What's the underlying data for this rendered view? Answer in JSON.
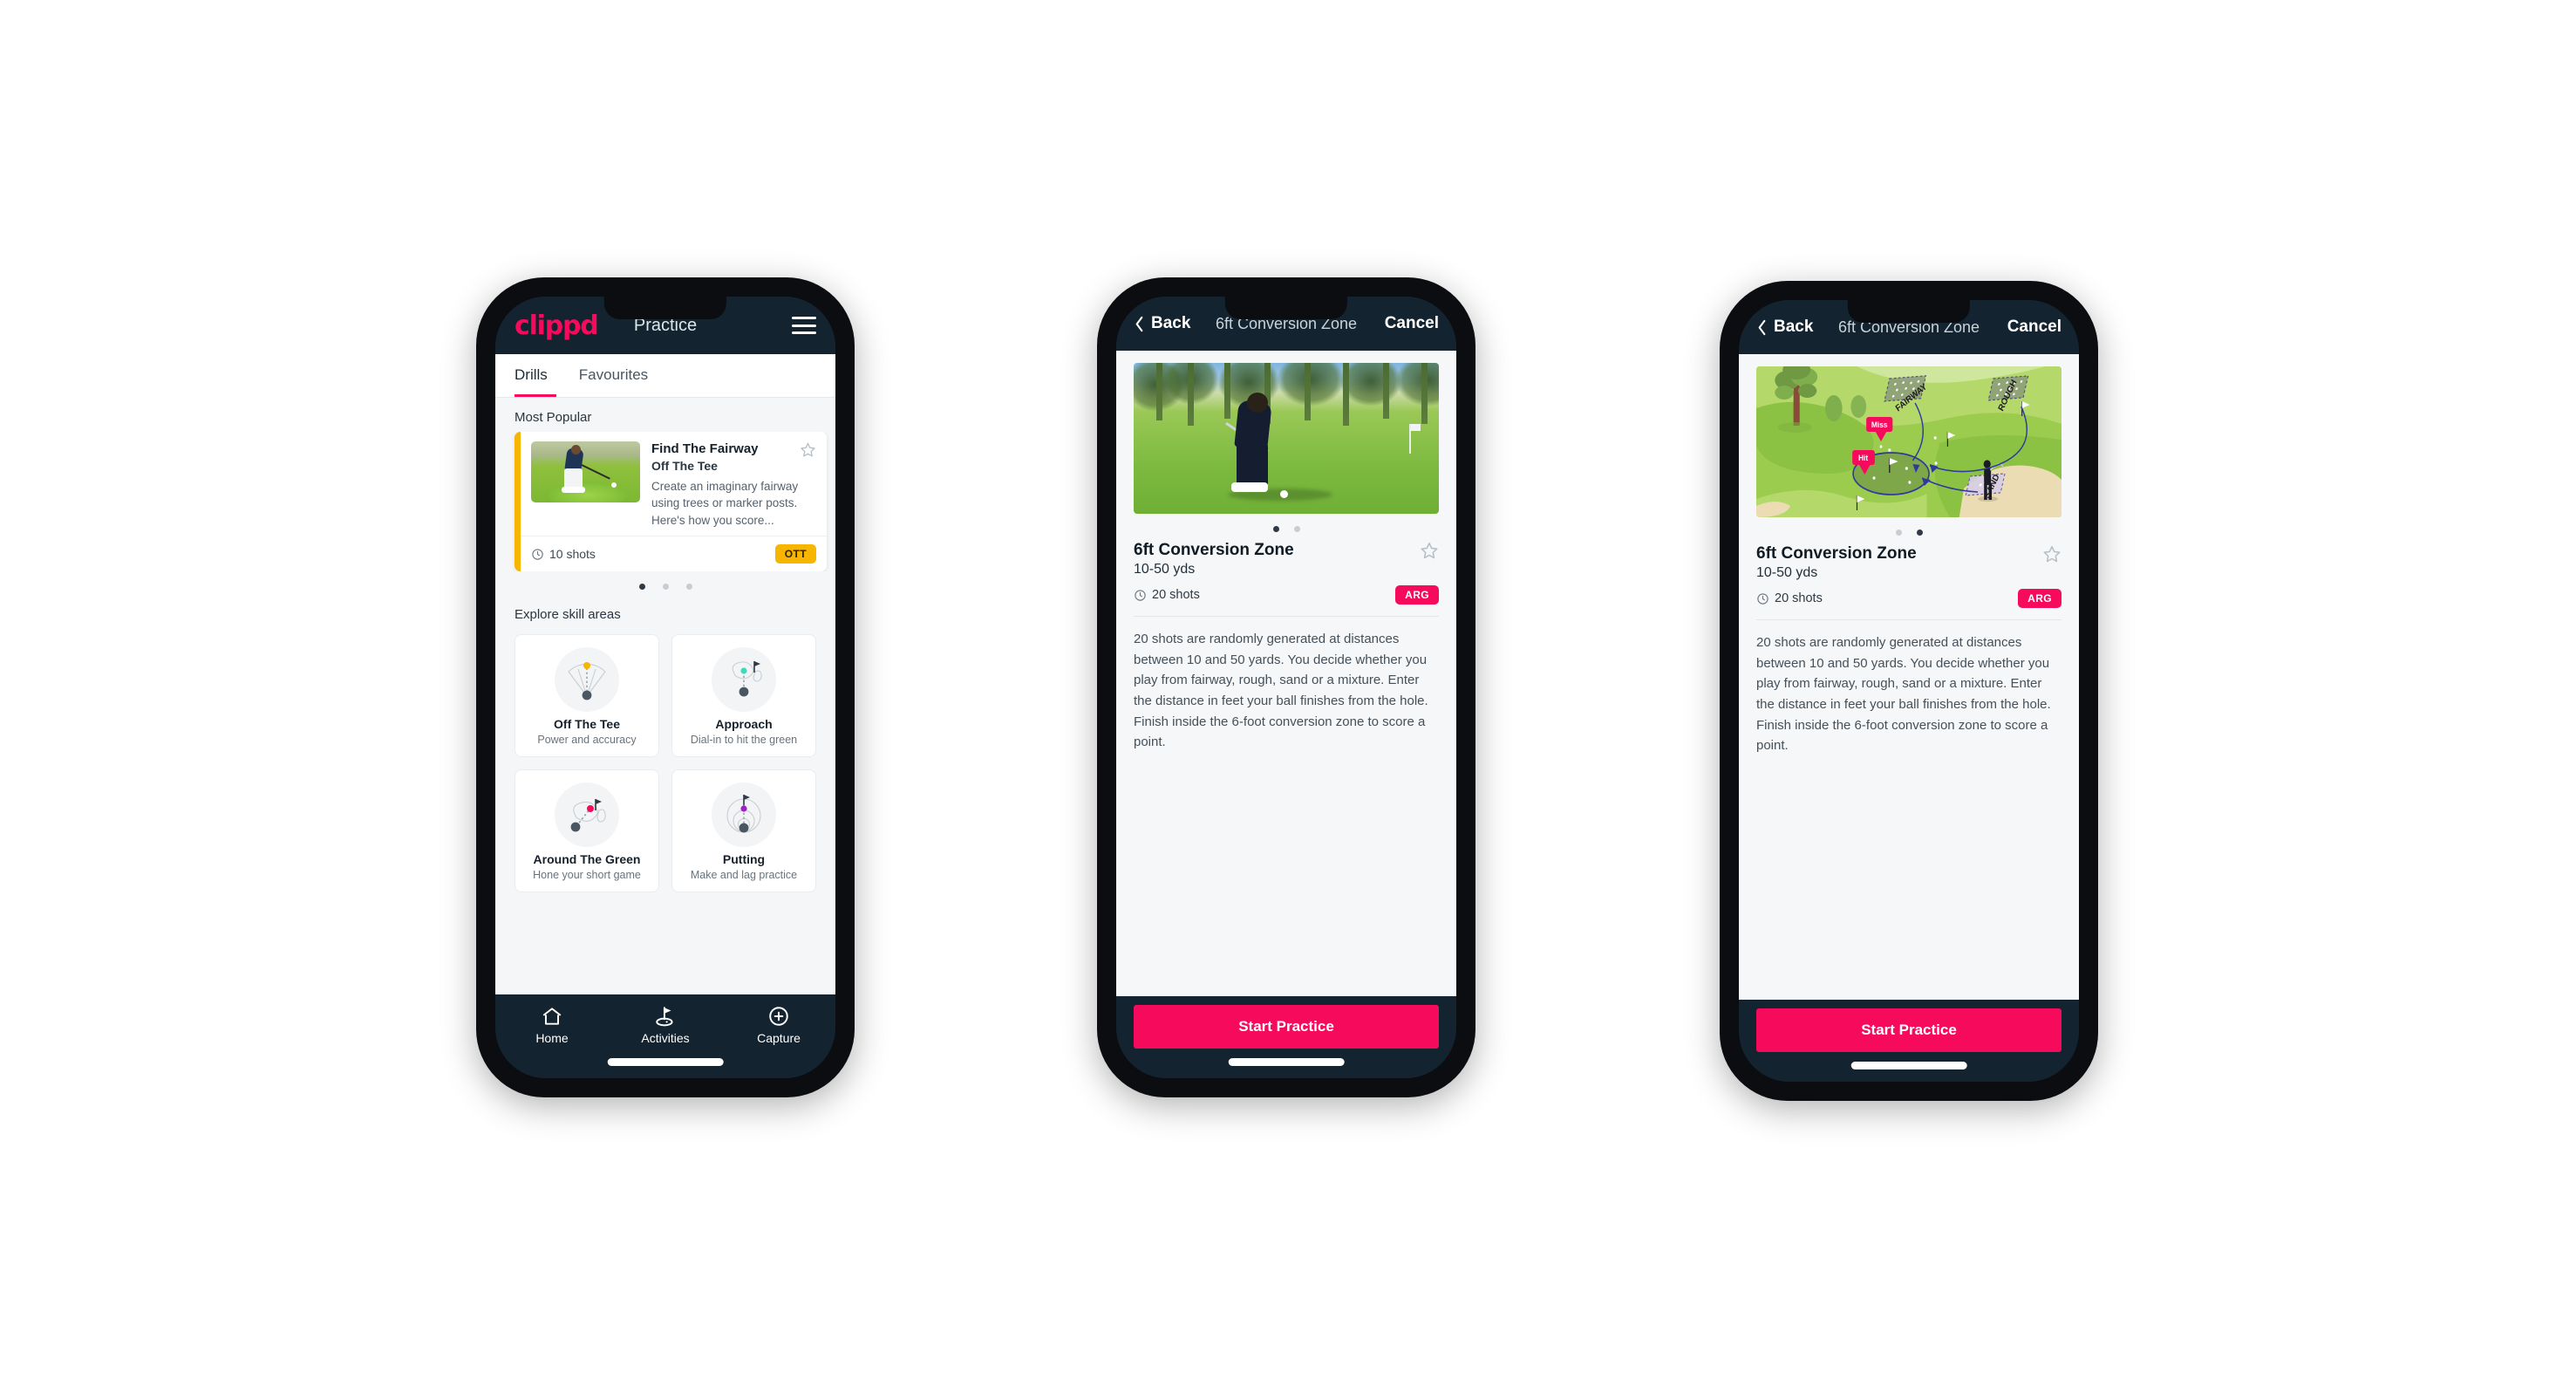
{
  "colors": {
    "brand_pink": "#F50A5C",
    "header_navy": "#13232F",
    "badge_ott": "#F7B500",
    "badge_arg": "#F50A5C",
    "accent_teal": "#3DDBBB",
    "page_bg": "#F4F6F7"
  },
  "phone1": {
    "topbar": {
      "logo": "clippd",
      "title": "Practice",
      "menu_icon": "hamburger-menu-icon"
    },
    "tabs": [
      {
        "label": "Drills",
        "active": true
      },
      {
        "label": "Favourites",
        "active": false
      }
    ],
    "most_popular": {
      "section_label": "Most Popular",
      "card": {
        "title": "Find The Fairway",
        "subtitle": "Off The Tee",
        "description": "Create an imaginary fairway using trees or marker posts. Here's how you score...",
        "shots": "10 shots",
        "badge": "OTT",
        "star_icon": "star-outline-icon",
        "clock_icon": "clock-icon",
        "accent": "#F7B500"
      },
      "dots": [
        true,
        false,
        false
      ]
    },
    "explore": {
      "section_label": "Explore skill areas",
      "cards": [
        {
          "name": "Off The Tee",
          "desc": "Power and accuracy",
          "icon": "tee-fan-icon",
          "accent": "#F7B500"
        },
        {
          "name": "Approach",
          "desc": "Dial-in to hit the green",
          "icon": "approach-green-icon",
          "accent": "#3DDBBB"
        },
        {
          "name": "Around The Green",
          "desc": "Hone your short game",
          "icon": "around-green-icon",
          "accent": "#F50A5C"
        },
        {
          "name": "Putting",
          "desc": "Make and lag practice",
          "icon": "putting-rings-icon",
          "accent": "#A020C8"
        }
      ]
    },
    "bottomnav": [
      {
        "label": "Home",
        "icon": "home-icon",
        "active": false
      },
      {
        "label": "Activities",
        "icon": "golf-flag-green-icon",
        "active": true
      },
      {
        "label": "Capture",
        "icon": "plus-circle-icon",
        "active": false
      }
    ]
  },
  "phone2": {
    "topbar": {
      "back_label": "Back",
      "back_icon": "chevron-left-icon",
      "title": "6ft Conversion Zone",
      "cancel_label": "Cancel"
    },
    "media": {
      "type": "photo",
      "alt": "golfer-chipping-photo"
    },
    "dots": [
      true,
      false
    ],
    "detail": {
      "title": "6ft Conversion Zone",
      "yardage": "10-50 yds",
      "shots": "20 shots",
      "badge": "ARG",
      "star_icon": "star-outline-icon",
      "clock_icon": "clock-icon",
      "description": "20 shots are randomly generated at distances between 10 and 50 yards. You decide whether you play from fairway, rough, sand or a mixture. Enter the distance in feet your ball finishes from the hole. Finish inside the 6-foot conversion zone to score a point."
    },
    "cta": "Start Practice"
  },
  "phone3": {
    "topbar": {
      "back_label": "Back",
      "back_icon": "chevron-left-icon",
      "title": "6ft Conversion Zone",
      "cancel_label": "Cancel"
    },
    "media": {
      "type": "illustration",
      "alt": "golf-hole-diagram",
      "labels": [
        "FAIRWAY",
        "ROUGH",
        "SAND"
      ],
      "markers": [
        "Miss",
        "Hit"
      ]
    },
    "dots": [
      false,
      true
    ],
    "detail": {
      "title": "6ft Conversion Zone",
      "yardage": "10-50 yds",
      "shots": "20 shots",
      "badge": "ARG",
      "star_icon": "star-outline-icon",
      "clock_icon": "clock-icon",
      "description": "20 shots are randomly generated at distances between 10 and 50 yards. You decide whether you play from fairway, rough, sand or a mixture. Enter the distance in feet your ball finishes from the hole. Finish inside the 6-foot conversion zone to score a point."
    },
    "cta": "Start Practice"
  }
}
